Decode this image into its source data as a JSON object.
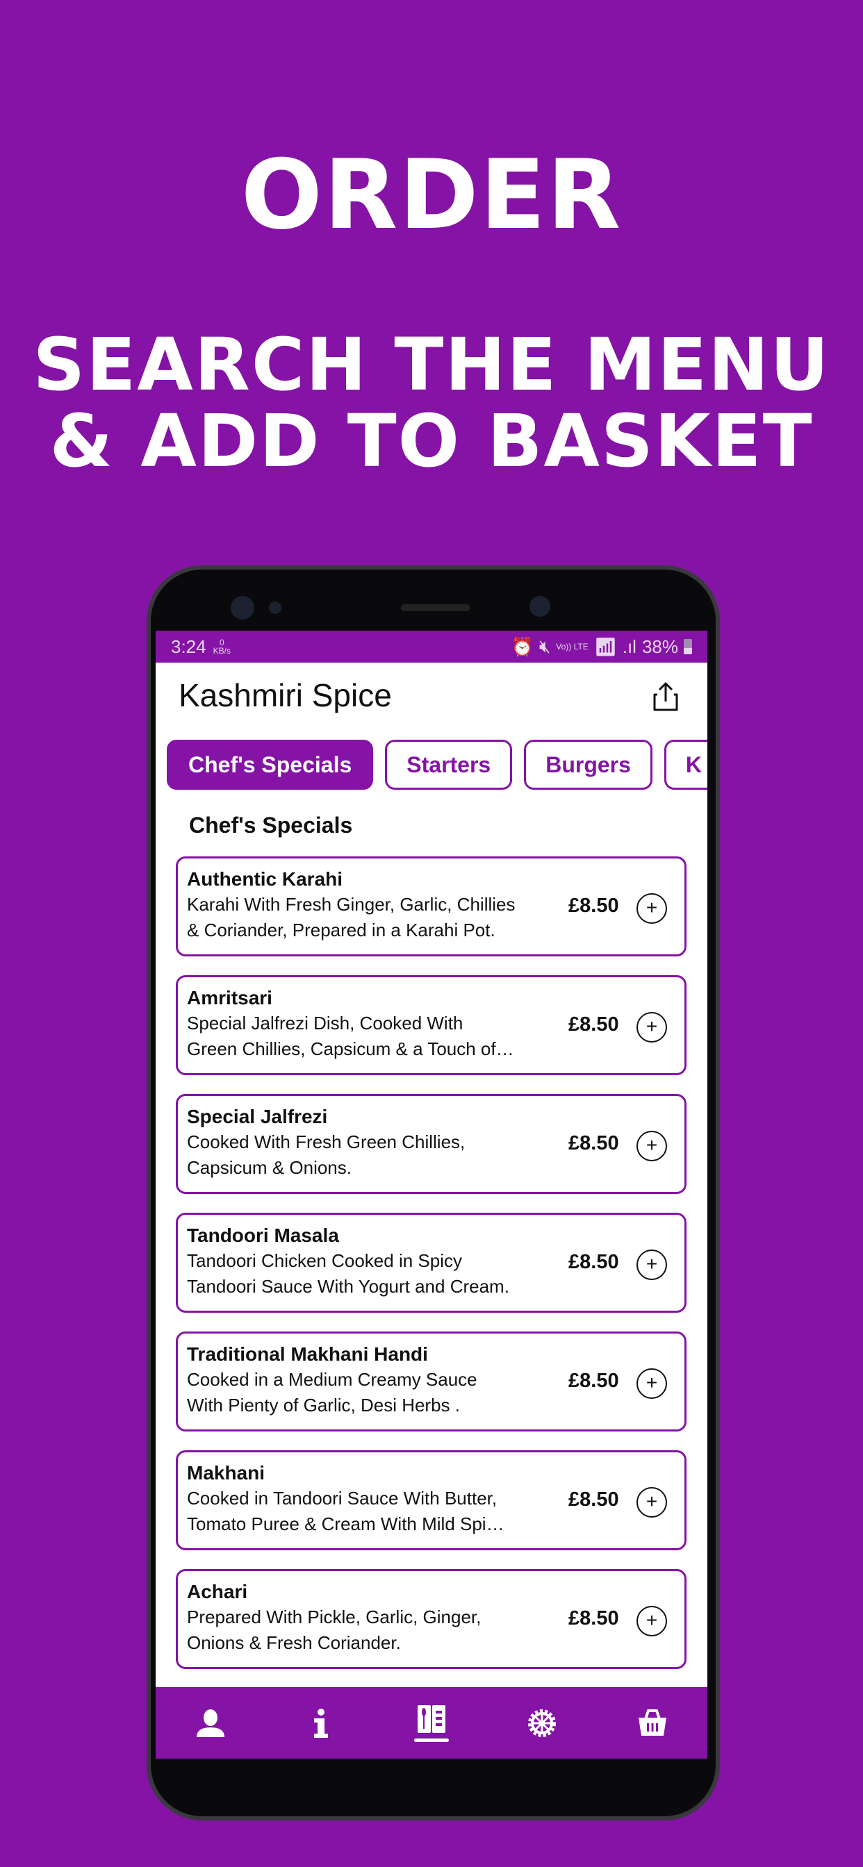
{
  "hero": {
    "title": "ORDER",
    "subtitle_line1": "SEARCH THE MENU",
    "subtitle_line2": "& ADD TO BASKET"
  },
  "status": {
    "time": "3:24",
    "speed_value": "0",
    "speed_unit": "KB/s",
    "network": "Vo)) LTE",
    "battery": "38%"
  },
  "header": {
    "title": "Kashmiri Spice",
    "share_icon": "share-icon"
  },
  "tabs": [
    {
      "label": "Chef's Specials",
      "active": true
    },
    {
      "label": "Starters"
    },
    {
      "label": "Burgers"
    },
    {
      "label": "K"
    }
  ],
  "section_title": "Chef's Specials",
  "items": [
    {
      "name": "Authentic Karahi",
      "desc1": "Karahi With Fresh Ginger, Garlic, Chillies",
      "desc2": "& Coriander, Prepared in a Karahi Pot.",
      "price": "£8.50",
      "add": "+"
    },
    {
      "name": "Amritsari",
      "desc1": "Special Jalfrezi Dish, Cooked With",
      "desc2": "Green Chillies, Capsicum & a Touch of…",
      "price": "£8.50",
      "add": "+"
    },
    {
      "name": "Special Jalfrezi",
      "desc1": "Cooked With Fresh Green Chillies,",
      "desc2": "Capsicum & Onions.",
      "price": "£8.50",
      "add": "+"
    },
    {
      "name": "Tandoori Masala",
      "desc1": "Tandoori Chicken Cooked in Spicy",
      "desc2": "Tandoori Sauce With Yogurt and Cream.",
      "price": "£8.50",
      "add": "+"
    },
    {
      "name": "Traditional Makhani Handi",
      "desc1": "Cooked in a Medium Creamy Sauce",
      "desc2": "With Pienty of Garlic, Desi Herbs .",
      "price": "£8.50",
      "add": "+"
    },
    {
      "name": "Makhani",
      "desc1": "Cooked in Tandoori Sauce With Butter,",
      "desc2": "Tomato Puree & Cream With Mild Spi…",
      "price": "£8.50",
      "add": "+"
    },
    {
      "name": "Achari",
      "desc1": "Prepared With Pickle, Garlic, Ginger,",
      "desc2": "Onions & Fresh Coriander.",
      "price": "£8.50",
      "add": "+"
    }
  ],
  "nav": [
    "user-icon",
    "info-icon",
    "menu-icon",
    "settings-icon",
    "basket-icon"
  ],
  "colors": {
    "brand": "#8513a5",
    "text": "#111111"
  }
}
